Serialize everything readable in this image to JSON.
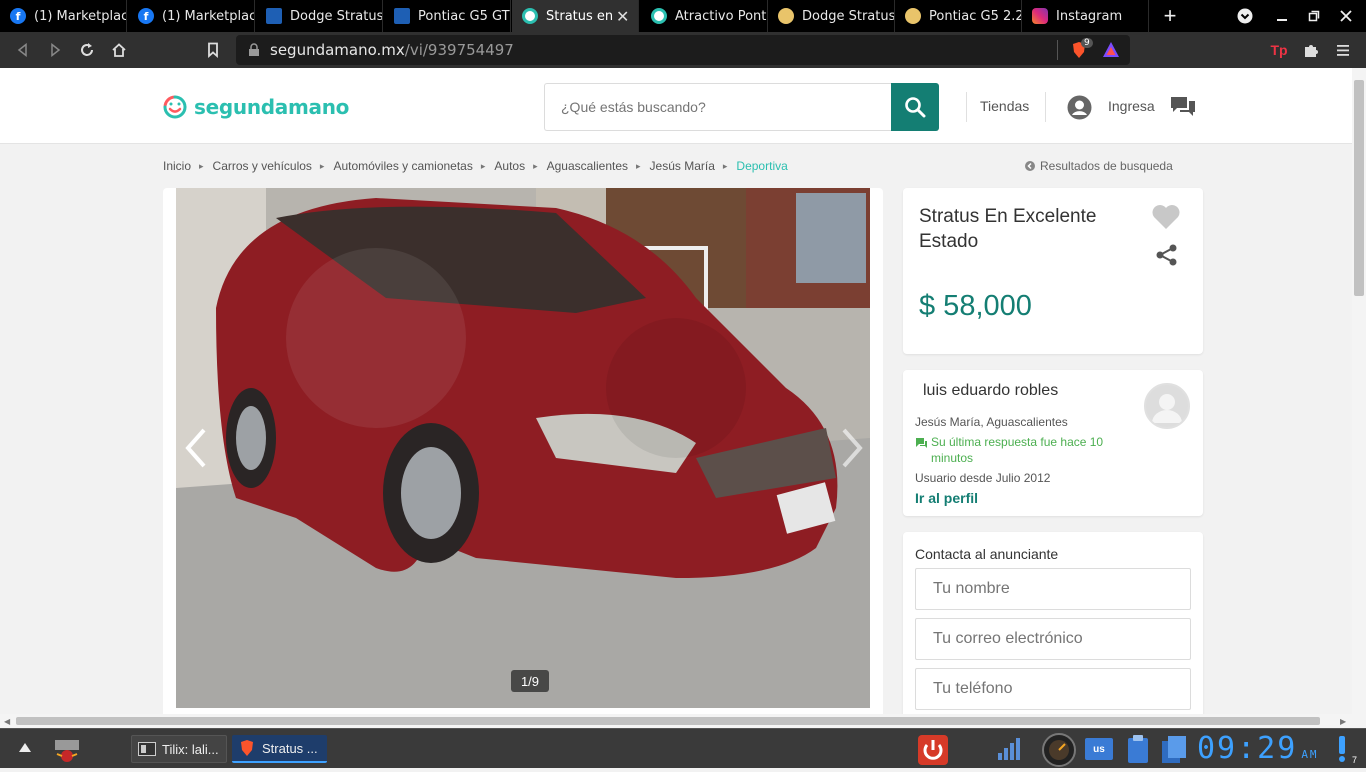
{
  "browser": {
    "tabs": [
      {
        "label": "(1) Marketplace",
        "icon": "facebook-icon",
        "active": false
      },
      {
        "label": "(1) Marketplace",
        "icon": "facebook-icon",
        "active": false
      },
      {
        "label": "Dodge Stratus",
        "icon": "kavak-icon",
        "active": false
      },
      {
        "label": "Pontiac G5 GT",
        "icon": "kavak-icon",
        "active": false
      },
      {
        "label": "Stratus en",
        "icon": "segundamano-icon",
        "active": true
      },
      {
        "label": "Atractivo Pont",
        "icon": "segundamano-icon",
        "active": false
      },
      {
        "label": "Dodge Stratus",
        "icon": "autos-icon",
        "active": false
      },
      {
        "label": "Pontiac G5 2.2",
        "icon": "autos-icon",
        "active": false
      },
      {
        "label": "Instagram",
        "icon": "instagram-icon",
        "active": false
      }
    ],
    "url_domain": "segundamano.mx",
    "url_path": "/vi/939754497",
    "brave_shield_count": "9"
  },
  "site": {
    "logo_text": "segundamano",
    "search_placeholder": "¿Qué estás buscando?",
    "stores_label": "Tiendas",
    "login_label": "Ingresa"
  },
  "breadcrumbs": [
    "Inicio",
    "Carros y vehículos",
    "Automóviles y camionetas",
    "Autos",
    "Aguascalientes",
    "Jesús María",
    "Deportiva"
  ],
  "results_link": "Resultados de busqueda",
  "gallery": {
    "counter": "1/9"
  },
  "ad": {
    "title": "Stratus En Excelente Estado",
    "price": "$ 58,000"
  },
  "seller": {
    "name": "luis eduardo robles",
    "location": "Jesús María, Aguascalientes",
    "last_response": "Su última respuesta fue hace 10 minutos",
    "member_since": "Usuario desde Julio 2012",
    "profile_link": "Ir al perfil"
  },
  "contact": {
    "title": "Contacta al anunciante",
    "name_placeholder": "Tu nombre",
    "email_placeholder": "Tu correo electrónico",
    "phone_placeholder": "Tu teléfono"
  },
  "taskbar": {
    "tilix_label": "Tilix: lali...",
    "brave_label": "Stratus ...",
    "keyboard_layout": "us",
    "clock": "09:29",
    "ampm": "AM",
    "notification_count": "7"
  },
  "colors": {
    "brand_teal": "#2bbfb0",
    "dark_teal": "#147e73",
    "green_status": "#4caf50"
  }
}
